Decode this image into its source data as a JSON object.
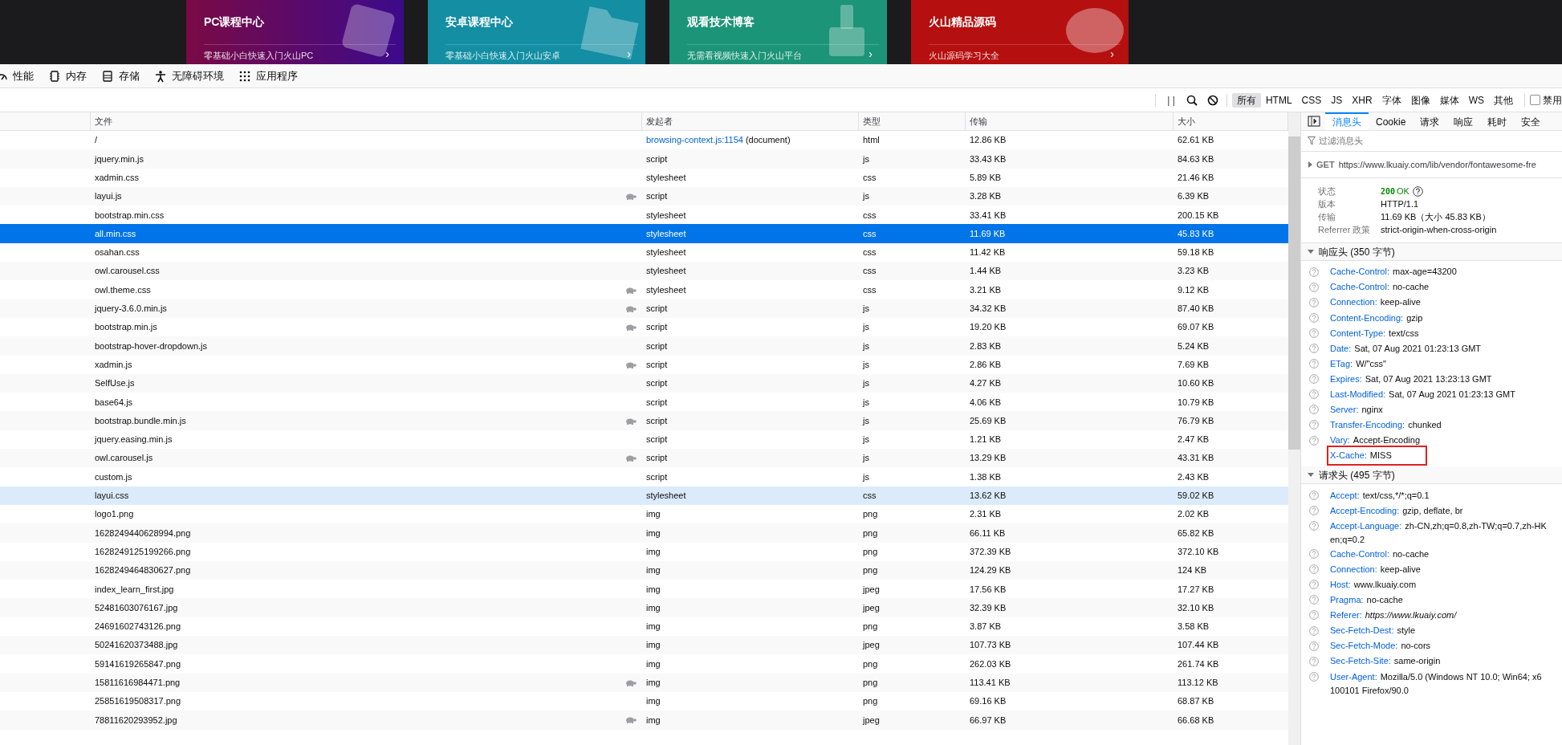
{
  "banner": {
    "cards": [
      {
        "kind": "pc",
        "title": "PC课程中心",
        "subtitle": "零基础小白快速入门火山PC",
        "arrow": "›"
      },
      {
        "kind": "android",
        "title": "安卓课程中心",
        "subtitle": "零基础小白快速入门火山安卓",
        "arrow": "›"
      },
      {
        "kind": "blog",
        "title": "观看技术博客",
        "subtitle": "无需看视频快速入门火山平台",
        "arrow": "›"
      },
      {
        "kind": "source",
        "title": "火山精品源码",
        "subtitle": "火山源码学习大全",
        "arrow": "›"
      }
    ]
  },
  "devtools_tabs": [
    {
      "kind": "gauge",
      "label": "性能"
    },
    {
      "kind": "chip",
      "label": "内存"
    },
    {
      "kind": "storage",
      "label": "存储"
    },
    {
      "kind": "person",
      "label": "无障碍环境"
    },
    {
      "kind": "grid",
      "label": "应用程序"
    }
  ],
  "filter_bar": {
    "pause": "| |",
    "types": [
      {
        "label": "所有",
        "selected": true
      },
      {
        "label": "HTML",
        "selected": false
      },
      {
        "label": "CSS",
        "selected": false
      },
      {
        "label": "JS",
        "selected": false
      },
      {
        "label": "XHR",
        "selected": false
      },
      {
        "label": "字体",
        "selected": false
      },
      {
        "label": "图像",
        "selected": false
      },
      {
        "label": "媒体",
        "selected": false
      },
      {
        "label": "WS",
        "selected": false
      },
      {
        "label": "其他",
        "selected": false
      }
    ],
    "disable_cache": {
      "label": "禁用",
      "checked": false
    }
  },
  "table": {
    "columns": [
      "文件",
      "发起者",
      "类型",
      "传输",
      "大小"
    ],
    "rows": [
      {
        "file": "/",
        "initiator": "browsing-context.js:1154",
        "initiator_detail": "(document)",
        "type": "html",
        "transfer": "12.86 KB",
        "size": "62.61 KB",
        "slow": false,
        "selected": false,
        "hovered": false
      },
      {
        "file": "jquery.min.js",
        "initiator": "script",
        "type": "js",
        "transfer": "33.43 KB",
        "size": "84.63 KB",
        "slow": false,
        "selected": false,
        "hovered": false
      },
      {
        "file": "xadmin.css",
        "initiator": "stylesheet",
        "type": "css",
        "transfer": "5.89 KB",
        "size": "21.46 KB",
        "slow": false,
        "selected": false,
        "hovered": false
      },
      {
        "file": "layui.js",
        "initiator": "script",
        "type": "js",
        "transfer": "3.28 KB",
        "size": "6.39 KB",
        "slow": true,
        "selected": false,
        "hovered": false
      },
      {
        "file": "bootstrap.min.css",
        "initiator": "stylesheet",
        "type": "css",
        "transfer": "33.41 KB",
        "size": "200.15 KB",
        "slow": false,
        "selected": false,
        "hovered": false
      },
      {
        "file": "all.min.css",
        "initiator": "stylesheet",
        "type": "css",
        "transfer": "11.69 KB",
        "size": "45.83 KB",
        "slow": false,
        "selected": true,
        "hovered": false
      },
      {
        "file": "osahan.css",
        "initiator": "stylesheet",
        "type": "css",
        "transfer": "11.42 KB",
        "size": "59.18 KB",
        "slow": false,
        "selected": false,
        "hovered": false
      },
      {
        "file": "owl.carousel.css",
        "initiator": "stylesheet",
        "type": "css",
        "transfer": "1.44 KB",
        "size": "3.23 KB",
        "slow": false,
        "selected": false,
        "hovered": false
      },
      {
        "file": "owl.theme.css",
        "initiator": "stylesheet",
        "type": "css",
        "transfer": "3.21 KB",
        "size": "9.12 KB",
        "slow": true,
        "selected": false,
        "hovered": false
      },
      {
        "file": "jquery-3.6.0.min.js",
        "initiator": "script",
        "type": "js",
        "transfer": "34.32 KB",
        "size": "87.40 KB",
        "slow": true,
        "selected": false,
        "hovered": false
      },
      {
        "file": "bootstrap.min.js",
        "initiator": "script",
        "type": "js",
        "transfer": "19.20 KB",
        "size": "69.07 KB",
        "slow": true,
        "selected": false,
        "hovered": false
      },
      {
        "file": "bootstrap-hover-dropdown.js",
        "initiator": "script",
        "type": "js",
        "transfer": "2.83 KB",
        "size": "5.24 KB",
        "slow": false,
        "selected": false,
        "hovered": false
      },
      {
        "file": "xadmin.js",
        "initiator": "script",
        "type": "js",
        "transfer": "2.86 KB",
        "size": "7.69 KB",
        "slow": true,
        "selected": false,
        "hovered": false
      },
      {
        "file": "SelfUse.js",
        "initiator": "script",
        "type": "js",
        "transfer": "4.27 KB",
        "size": "10.60 KB",
        "slow": false,
        "selected": false,
        "hovered": false
      },
      {
        "file": "base64.js",
        "initiator": "script",
        "type": "js",
        "transfer": "4.06 KB",
        "size": "10.79 KB",
        "slow": false,
        "selected": false,
        "hovered": false
      },
      {
        "file": "bootstrap.bundle.min.js",
        "initiator": "script",
        "type": "js",
        "transfer": "25.69 KB",
        "size": "76.79 KB",
        "slow": true,
        "selected": false,
        "hovered": false
      },
      {
        "file": "jquery.easing.min.js",
        "initiator": "script",
        "type": "js",
        "transfer": "1.21 KB",
        "size": "2.47 KB",
        "slow": false,
        "selected": false,
        "hovered": false
      },
      {
        "file": "owl.carousel.js",
        "initiator": "script",
        "type": "js",
        "transfer": "13.29 KB",
        "size": "43.31 KB",
        "slow": true,
        "selected": false,
        "hovered": false
      },
      {
        "file": "custom.js",
        "initiator": "script",
        "type": "js",
        "transfer": "1.38 KB",
        "size": "2.43 KB",
        "slow": false,
        "selected": false,
        "hovered": false
      },
      {
        "file": "layui.css",
        "initiator": "stylesheet",
        "type": "css",
        "transfer": "13.62 KB",
        "size": "59.02 KB",
        "slow": false,
        "selected": false,
        "hovered": true
      },
      {
        "file": "logo1.png",
        "initiator": "img",
        "type": "png",
        "transfer": "2.31 KB",
        "size": "2.02 KB",
        "slow": false,
        "selected": false,
        "hovered": false
      },
      {
        "file": "1628249440628994.png",
        "initiator": "img",
        "type": "png",
        "transfer": "66.11 KB",
        "size": "65.82 KB",
        "slow": false,
        "selected": false,
        "hovered": false
      },
      {
        "file": "1628249125199266.png",
        "initiator": "img",
        "type": "png",
        "transfer": "372.39 KB",
        "size": "372.10 KB",
        "slow": false,
        "selected": false,
        "hovered": false
      },
      {
        "file": "1628249464830627.png",
        "initiator": "img",
        "type": "png",
        "transfer": "124.29 KB",
        "size": "124 KB",
        "slow": false,
        "selected": false,
        "hovered": false
      },
      {
        "file": "index_learn_first.jpg",
        "initiator": "img",
        "type": "jpeg",
        "transfer": "17.56 KB",
        "size": "17.27 KB",
        "slow": false,
        "selected": false,
        "hovered": false
      },
      {
        "file": "52481603076167.jpg",
        "initiator": "img",
        "type": "jpeg",
        "transfer": "32.39 KB",
        "size": "32.10 KB",
        "slow": false,
        "selected": false,
        "hovered": false
      },
      {
        "file": "24691602743126.png",
        "initiator": "img",
        "type": "png",
        "transfer": "3.87 KB",
        "size": "3.58 KB",
        "slow": false,
        "selected": false,
        "hovered": false
      },
      {
        "file": "50241620373488.jpg",
        "initiator": "img",
        "type": "jpeg",
        "transfer": "107.73 KB",
        "size": "107.44 KB",
        "slow": false,
        "selected": false,
        "hovered": false
      },
      {
        "file": "59141619265847.png",
        "initiator": "img",
        "type": "png",
        "transfer": "262.03 KB",
        "size": "261.74 KB",
        "slow": false,
        "selected": false,
        "hovered": false
      },
      {
        "file": "15811616984471.png",
        "initiator": "img",
        "type": "png",
        "transfer": "113.41 KB",
        "size": "113.12 KB",
        "slow": true,
        "selected": false,
        "hovered": false
      },
      {
        "file": "25851619508317.png",
        "initiator": "img",
        "type": "png",
        "transfer": "69.16 KB",
        "size": "68.87 KB",
        "slow": false,
        "selected": false,
        "hovered": false
      },
      {
        "file": "78811620293952.jpg",
        "initiator": "img",
        "type": "jpeg",
        "transfer": "66.97 KB",
        "size": "66.68 KB",
        "slow": true,
        "selected": false,
        "hovered": false
      }
    ]
  },
  "details": {
    "tabs": [
      {
        "label": "消息头",
        "selected": true
      },
      {
        "label": "Cookie",
        "selected": false
      },
      {
        "label": "请求",
        "selected": false
      },
      {
        "label": "响应",
        "selected": false
      },
      {
        "label": "耗时",
        "selected": false
      },
      {
        "label": "安全",
        "selected": false
      }
    ],
    "filter": {
      "placeholder": "过滤消息头"
    },
    "request": {
      "method": "GET",
      "url": "https://www.lkuaiy.com/lib/vendor/fontawesome-fre"
    },
    "summary": [
      {
        "kind": "status",
        "label": "状态",
        "code": "200",
        "value": "OK"
      },
      {
        "kind": "plain",
        "label": "版本",
        "value": "HTTP/1.1"
      },
      {
        "kind": "plain",
        "label": "传输",
        "value": "11.69 KB（大小 45.83 KB）"
      },
      {
        "kind": "plain",
        "label": "Referrer 政策",
        "value": "strict-origin-when-cross-origin"
      }
    ],
    "sections": [
      {
        "title": "响应头 (350 字节)",
        "expanded": true,
        "headers": [
          {
            "name": "Cache-Control:",
            "value": "max-age=43200",
            "help": true,
            "italic": false,
            "marked": false
          },
          {
            "name": "Cache-Control:",
            "value": "no-cache",
            "help": true,
            "italic": false,
            "marked": false
          },
          {
            "name": "Connection:",
            "value": "keep-alive",
            "help": true,
            "italic": false,
            "marked": false
          },
          {
            "name": "Content-Encoding:",
            "value": "gzip",
            "help": true,
            "italic": false,
            "marked": false
          },
          {
            "name": "Content-Type:",
            "value": "text/css",
            "help": true,
            "italic": false,
            "marked": false
          },
          {
            "name": "Date:",
            "value": "Sat, 07 Aug 2021 01:23:13 GMT",
            "help": true,
            "italic": false,
            "marked": false
          },
          {
            "name": "ETag:",
            "value": "W/\"css\"",
            "help": true,
            "italic": false,
            "marked": false
          },
          {
            "name": "Expires:",
            "value": "Sat, 07 Aug 2021 13:23:13 GMT",
            "help": true,
            "italic": false,
            "marked": false
          },
          {
            "name": "Last-Modified:",
            "value": "Sat, 07 Aug 2021 01:23:13 GMT",
            "help": true,
            "italic": false,
            "marked": false
          },
          {
            "name": "Server:",
            "value": "nginx",
            "help": true,
            "italic": false,
            "marked": false
          },
          {
            "name": "Transfer-Encoding:",
            "value": "chunked",
            "help": true,
            "italic": false,
            "marked": false
          },
          {
            "name": "Vary:",
            "value": "Accept-Encoding",
            "help": true,
            "italic": false,
            "marked": false
          },
          {
            "name": "X-Cache:",
            "value": "MISS",
            "help": false,
            "italic": false,
            "marked": true
          }
        ]
      },
      {
        "title": "请求头 (495 字节)",
        "expanded": true,
        "headers": [
          {
            "name": "Accept:",
            "value": "text/css,*/*;q=0.1",
            "help": true,
            "italic": false,
            "marked": false
          },
          {
            "name": "Accept-Encoding:",
            "value": "gzip, deflate, br",
            "help": true,
            "italic": false,
            "marked": false
          },
          {
            "name": "Accept-Language:",
            "value": "zh-CN,zh;q=0.8,zh-TW;q=0.7,zh-HK",
            "continuation": "en;q=0.2",
            "help": true,
            "italic": false,
            "marked": false
          },
          {
            "name": "Cache-Control:",
            "value": "no-cache",
            "help": true,
            "italic": false,
            "marked": false
          },
          {
            "name": "Connection:",
            "value": "keep-alive",
            "help": true,
            "italic": false,
            "marked": false
          },
          {
            "name": "Host:",
            "value": "www.lkuaiy.com",
            "help": true,
            "italic": false,
            "marked": false
          },
          {
            "name": "Pragma:",
            "value": "no-cache",
            "help": true,
            "italic": false,
            "marked": false
          },
          {
            "name": "Referer:",
            "value": "https://www.lkuaiy.com/",
            "help": true,
            "italic": true,
            "marked": false
          },
          {
            "name": "Sec-Fetch-Dest:",
            "value": "style",
            "help": true,
            "italic": false,
            "marked": false
          },
          {
            "name": "Sec-Fetch-Mode:",
            "value": "no-cors",
            "help": true,
            "italic": false,
            "marked": false
          },
          {
            "name": "Sec-Fetch-Site:",
            "value": "same-origin",
            "help": true,
            "italic": false,
            "marked": false
          },
          {
            "name": "User-Agent:",
            "value": "Mozilla/5.0 (Windows NT 10.0; Win64; x6",
            "continuation": "100101 Firefox/90.0",
            "help": true,
            "italic": false,
            "marked": false
          }
        ]
      }
    ]
  }
}
